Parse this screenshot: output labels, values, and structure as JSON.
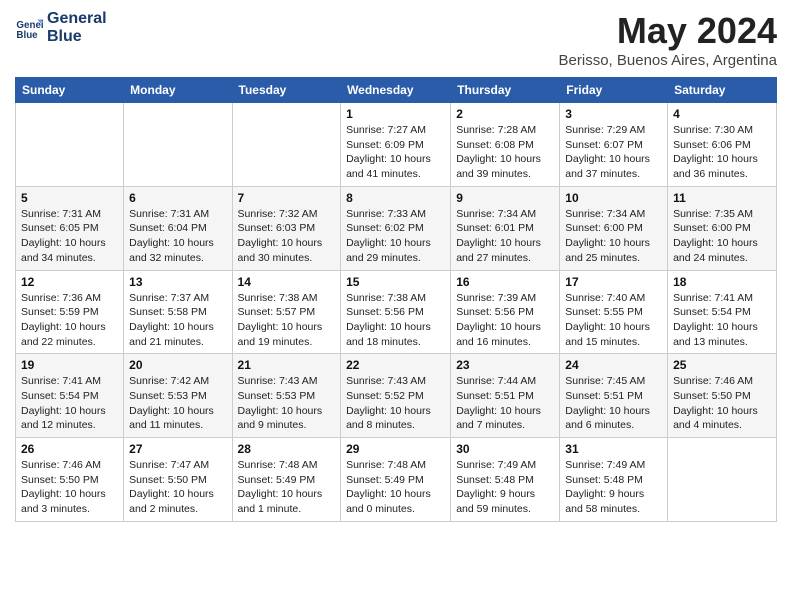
{
  "header": {
    "logo_line1": "General",
    "logo_line2": "Blue",
    "month_title": "May 2024",
    "location": "Berisso, Buenos Aires, Argentina"
  },
  "days_of_week": [
    "Sunday",
    "Monday",
    "Tuesday",
    "Wednesday",
    "Thursday",
    "Friday",
    "Saturday"
  ],
  "weeks": [
    [
      {
        "day": "",
        "detail": ""
      },
      {
        "day": "",
        "detail": ""
      },
      {
        "day": "",
        "detail": ""
      },
      {
        "day": "1",
        "detail": "Sunrise: 7:27 AM\nSunset: 6:09 PM\nDaylight: 10 hours\nand 41 minutes."
      },
      {
        "day": "2",
        "detail": "Sunrise: 7:28 AM\nSunset: 6:08 PM\nDaylight: 10 hours\nand 39 minutes."
      },
      {
        "day": "3",
        "detail": "Sunrise: 7:29 AM\nSunset: 6:07 PM\nDaylight: 10 hours\nand 37 minutes."
      },
      {
        "day": "4",
        "detail": "Sunrise: 7:30 AM\nSunset: 6:06 PM\nDaylight: 10 hours\nand 36 minutes."
      }
    ],
    [
      {
        "day": "5",
        "detail": "Sunrise: 7:31 AM\nSunset: 6:05 PM\nDaylight: 10 hours\nand 34 minutes."
      },
      {
        "day": "6",
        "detail": "Sunrise: 7:31 AM\nSunset: 6:04 PM\nDaylight: 10 hours\nand 32 minutes."
      },
      {
        "day": "7",
        "detail": "Sunrise: 7:32 AM\nSunset: 6:03 PM\nDaylight: 10 hours\nand 30 minutes."
      },
      {
        "day": "8",
        "detail": "Sunrise: 7:33 AM\nSunset: 6:02 PM\nDaylight: 10 hours\nand 29 minutes."
      },
      {
        "day": "9",
        "detail": "Sunrise: 7:34 AM\nSunset: 6:01 PM\nDaylight: 10 hours\nand 27 minutes."
      },
      {
        "day": "10",
        "detail": "Sunrise: 7:34 AM\nSunset: 6:00 PM\nDaylight: 10 hours\nand 25 minutes."
      },
      {
        "day": "11",
        "detail": "Sunrise: 7:35 AM\nSunset: 6:00 PM\nDaylight: 10 hours\nand 24 minutes."
      }
    ],
    [
      {
        "day": "12",
        "detail": "Sunrise: 7:36 AM\nSunset: 5:59 PM\nDaylight: 10 hours\nand 22 minutes."
      },
      {
        "day": "13",
        "detail": "Sunrise: 7:37 AM\nSunset: 5:58 PM\nDaylight: 10 hours\nand 21 minutes."
      },
      {
        "day": "14",
        "detail": "Sunrise: 7:38 AM\nSunset: 5:57 PM\nDaylight: 10 hours\nand 19 minutes."
      },
      {
        "day": "15",
        "detail": "Sunrise: 7:38 AM\nSunset: 5:56 PM\nDaylight: 10 hours\nand 18 minutes."
      },
      {
        "day": "16",
        "detail": "Sunrise: 7:39 AM\nSunset: 5:56 PM\nDaylight: 10 hours\nand 16 minutes."
      },
      {
        "day": "17",
        "detail": "Sunrise: 7:40 AM\nSunset: 5:55 PM\nDaylight: 10 hours\nand 15 minutes."
      },
      {
        "day": "18",
        "detail": "Sunrise: 7:41 AM\nSunset: 5:54 PM\nDaylight: 10 hours\nand 13 minutes."
      }
    ],
    [
      {
        "day": "19",
        "detail": "Sunrise: 7:41 AM\nSunset: 5:54 PM\nDaylight: 10 hours\nand 12 minutes."
      },
      {
        "day": "20",
        "detail": "Sunrise: 7:42 AM\nSunset: 5:53 PM\nDaylight: 10 hours\nand 11 minutes."
      },
      {
        "day": "21",
        "detail": "Sunrise: 7:43 AM\nSunset: 5:53 PM\nDaylight: 10 hours\nand 9 minutes."
      },
      {
        "day": "22",
        "detail": "Sunrise: 7:43 AM\nSunset: 5:52 PM\nDaylight: 10 hours\nand 8 minutes."
      },
      {
        "day": "23",
        "detail": "Sunrise: 7:44 AM\nSunset: 5:51 PM\nDaylight: 10 hours\nand 7 minutes."
      },
      {
        "day": "24",
        "detail": "Sunrise: 7:45 AM\nSunset: 5:51 PM\nDaylight: 10 hours\nand 6 minutes."
      },
      {
        "day": "25",
        "detail": "Sunrise: 7:46 AM\nSunset: 5:50 PM\nDaylight: 10 hours\nand 4 minutes."
      }
    ],
    [
      {
        "day": "26",
        "detail": "Sunrise: 7:46 AM\nSunset: 5:50 PM\nDaylight: 10 hours\nand 3 minutes."
      },
      {
        "day": "27",
        "detail": "Sunrise: 7:47 AM\nSunset: 5:50 PM\nDaylight: 10 hours\nand 2 minutes."
      },
      {
        "day": "28",
        "detail": "Sunrise: 7:48 AM\nSunset: 5:49 PM\nDaylight: 10 hours\nand 1 minute."
      },
      {
        "day": "29",
        "detail": "Sunrise: 7:48 AM\nSunset: 5:49 PM\nDaylight: 10 hours\nand 0 minutes."
      },
      {
        "day": "30",
        "detail": "Sunrise: 7:49 AM\nSunset: 5:48 PM\nDaylight: 9 hours\nand 59 minutes."
      },
      {
        "day": "31",
        "detail": "Sunrise: 7:49 AM\nSunset: 5:48 PM\nDaylight: 9 hours\nand 58 minutes."
      },
      {
        "day": "",
        "detail": ""
      }
    ]
  ]
}
